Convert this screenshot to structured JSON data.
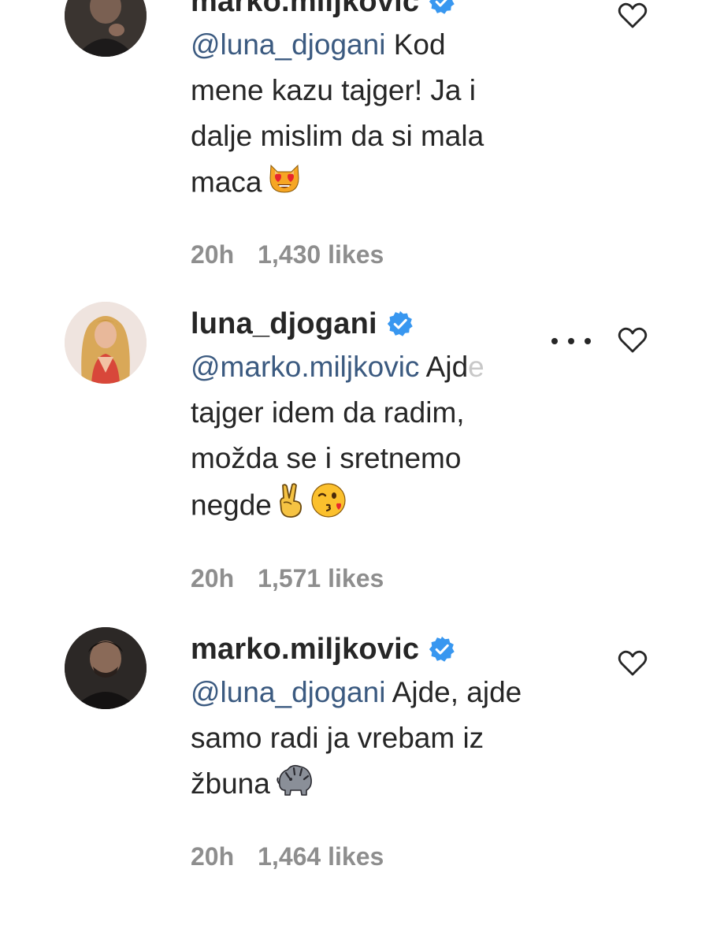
{
  "comments": [
    {
      "username": "marko.miljkovic",
      "verified": true,
      "mention": "@luna_djogani",
      "text_lines": [
        "Kod",
        "mene kazu tajger! Ja i",
        "dalje mislim da si mala",
        "maca"
      ],
      "emoji": [
        "heart-eyes-cat"
      ],
      "time": "20h",
      "likes": "1,430 likes",
      "avatar": "male-dark"
    },
    {
      "username": "luna_djogani",
      "verified": true,
      "mention": "@marko.miljkovic",
      "text_lines": [
        "Ajd",
        "tajger idem da radim,",
        "možda se i sretnemo",
        "negde"
      ],
      "text_fade": "e",
      "emoji": [
        "victory-hand",
        "kissing-face-wink"
      ],
      "time": "20h",
      "likes": "1,571 likes",
      "avatar": "female-blonde"
    },
    {
      "username": "marko.miljkovic",
      "verified": true,
      "mention": "@luna_djogani",
      "text_lines": [
        "Ajde, ajde",
        "samo radi ja vrebam iz",
        "žbuna"
      ],
      "emoji": [
        "tiger"
      ],
      "time": "20h",
      "likes": "1,464 likes",
      "avatar": "male-dark"
    }
  ],
  "colors": {
    "mention": "#3b5a80",
    "verified": "#3897f0",
    "meta": "#8e8e8e",
    "text": "#262626"
  }
}
